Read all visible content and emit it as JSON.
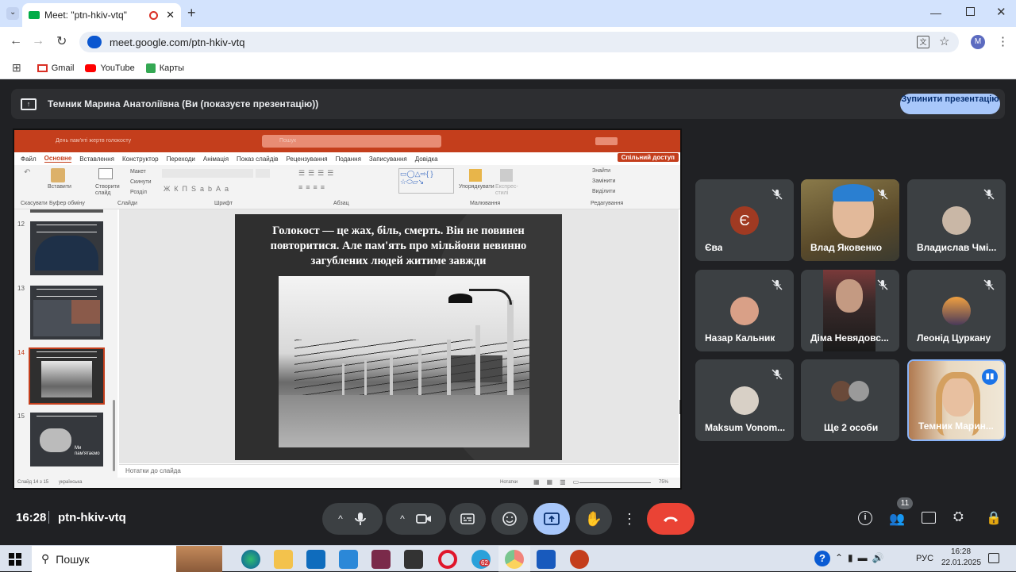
{
  "browser": {
    "tab_title": "Meet: \"ptn-hkiv-vtq\"",
    "url": "meet.google.com/ptn-hkiv-vtq",
    "bookmarks": [
      "Gmail",
      "YouTube",
      "Карты"
    ],
    "profile_initial": "M"
  },
  "presenting": {
    "banner": "Темник Марина Анатоліївна (Ви (показуєте презентацію))",
    "stop_button": "Зупинити презентацію"
  },
  "ppt": {
    "title": "День пам'яті жертв голокосту",
    "search": "Пошук",
    "share": "Спільний доступ",
    "menu": [
      "Файл",
      "Основне",
      "Вставлення",
      "Конструктор",
      "Переходи",
      "Анімація",
      "Показ слайдів",
      "Рецензування",
      "Подання",
      "Записування",
      "Довідка"
    ],
    "ribbon_groups": [
      "Буфер обміну",
      "Слайди",
      "Шрифт",
      "Абзац",
      "Малювання",
      "Редагування"
    ],
    "ribbon_labels": {
      "paste": "Вставити",
      "new_slide": "Створити слайд",
      "layout": "Макет",
      "reset": "Скинути",
      "section": "Розділ",
      "arrange": "Упорядкувати",
      "express": "Експрес-стилі",
      "find": "Знайти",
      "replace": "Замінити",
      "select": "Виділити",
      "undo": "Скасувати"
    },
    "slide_numbers": [
      "12",
      "13",
      "14",
      "15"
    ],
    "thumb15_text": "Ми пам'ятаємо",
    "slide_text": "Голокост — це жах, біль, смерть. Він не повинен повторитися. Але пам'ять про мільйони невинно загублених людей житиме завжди",
    "notes": "Нотатки до слайда",
    "status_left": "Слайд 14 з 15",
    "status_lang": "українська",
    "notes_btn": "Нотатки",
    "zoom": "75%"
  },
  "participants": [
    {
      "name": "Єва",
      "initial": "Є",
      "color": "#a03a22"
    },
    {
      "name": "Влад Яковенко"
    },
    {
      "name": "Владислав Чмі..."
    },
    {
      "name": "Назар Кальник"
    },
    {
      "name": "Діма Невядовс..."
    },
    {
      "name": "Леонід Цуркану"
    },
    {
      "name": "Maksum Vonom..."
    },
    {
      "name": "Ще 2 особи"
    },
    {
      "name": "Темник Марин..."
    }
  ],
  "meeting": {
    "time": "16:28",
    "code": "ptn-hkiv-vtq",
    "participant_count": "11"
  },
  "taskbar": {
    "search": "Пошук",
    "lang": "РУС",
    "time": "16:28",
    "date": "22.01.2025",
    "badge": "62"
  }
}
